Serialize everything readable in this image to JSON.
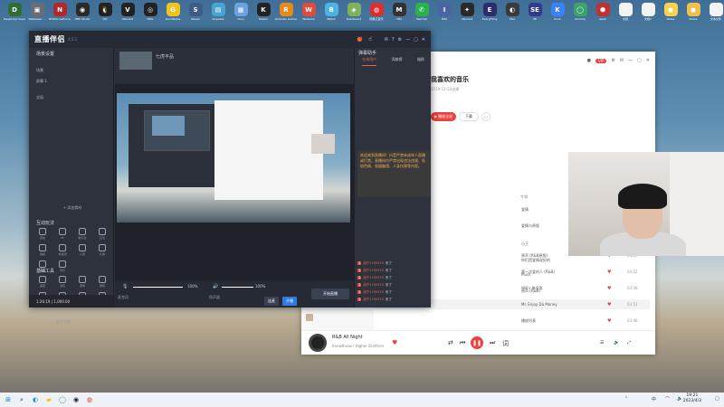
{
  "desktop": {
    "icons": [
      {
        "label": "Deepkdup Super...",
        "color": "#2f6e33",
        "glyph": "D"
      },
      {
        "label": "Wallpaper ...",
        "color": "#6b6d74",
        "glyph": "▣"
      },
      {
        "label": "NVIDIA GeForce...",
        "color": "#b3262b",
        "glyph": "N"
      },
      {
        "label": "OBS Studio",
        "color": "#2a2a2a",
        "glyph": "◉"
      },
      {
        "label": "QQ",
        "color": "#222",
        "glyph": "🐧"
      },
      {
        "label": "Valorant",
        "color": "#222",
        "glyph": "V"
      },
      {
        "label": "ROG",
        "color": "#222",
        "glyph": "◎"
      },
      {
        "label": "GoodNotes",
        "color": "#f2c31a",
        "glyph": "G"
      },
      {
        "label": "Steam",
        "color": "#3e5c88",
        "glyph": "S"
      },
      {
        "label": "Snipaste",
        "color": "#4ba3d4",
        "glyph": "▤"
      },
      {
        "label": "Docs",
        "color": "#6aa3df",
        "glyph": "▦"
      },
      {
        "label": "Kazam",
        "color": "#232323",
        "glyph": "K"
      },
      {
        "label": "Rockstar Games",
        "color": "#e88a1a",
        "glyph": "R"
      },
      {
        "label": "WeGame",
        "color": "#e44a3b",
        "glyph": "W"
      },
      {
        "label": "Bilibili",
        "color": "#4bb4e3",
        "glyph": "B"
      },
      {
        "label": "Dashboard",
        "color": "#7fb35a",
        "glyph": "◈"
      },
      {
        "label": "网易云音乐",
        "color": "#d9302c",
        "glyph": "◍"
      },
      {
        "label": "MSI",
        "color": "#333",
        "glyph": "M"
      },
      {
        "label": "WeChat",
        "color": "#2bb24c",
        "glyph": "✆"
      },
      {
        "label": "IDM",
        "color": "#4b64a4",
        "glyph": "I"
      },
      {
        "label": "Valorant",
        "color": "#2a2a2a",
        "glyph": "✦"
      },
      {
        "label": "Everything",
        "color": "#2d2d6d",
        "glyph": "E"
      },
      {
        "label": "Plex",
        "color": "#3a3a3a",
        "glyph": "◐"
      },
      {
        "label": "SE",
        "color": "#303c8a",
        "glyph": "SE"
      },
      {
        "label": "Kook",
        "color": "#3b82f6",
        "glyph": "K"
      },
      {
        "label": "Chrome",
        "color": "#3da36a",
        "glyph": "◯"
      },
      {
        "label": "Geek",
        "color": "#c42f2f",
        "glyph": "⬢"
      },
      {
        "label": "文档",
        "color": "#f2f2f2",
        "glyph": "▯"
      },
      {
        "label": "文档2",
        "color": "#f2f2f2",
        "glyph": "▯"
      },
      {
        "label": "Notes",
        "color": "#f6d34a",
        "glyph": "◼"
      },
      {
        "label": "Note2",
        "color": "#f1c04a",
        "glyph": "◼"
      },
      {
        "label": "文本文件",
        "color": "#f2f2f2",
        "glyph": "▯"
      }
    ]
  },
  "stream_app": {
    "logo": "直播伴侣",
    "version": "4.5.1",
    "scene_panel_title": "场景设置",
    "scene_items": [
      "场景",
      "屏幕 1",
      "全局"
    ],
    "add_source_label": "+ 添加素材",
    "interaction_title": "互动玩法",
    "interaction_icons": [
      "连线",
      "PK",
      "聊天室",
      "红包",
      "福袋",
      "粉丝团",
      "心愿",
      "礼物",
      "投票",
      "音乐"
    ],
    "tools_title": "基础工具",
    "tools_icons": [
      "美颜",
      "滤镜",
      "录屏",
      "弹幕",
      "分享",
      "直播间",
      "设置",
      "更多"
    ],
    "more_label": "更多功能",
    "go_live_label": "开始直播",
    "mic_label": "麦克风",
    "speaker_label": "扬声器",
    "mic_pct": "100%",
    "speaker_pct": "100%",
    "chat_panel_title": "弹幕助手",
    "chat_tabs": [
      "在线用户",
      "贡献榜",
      "福袋"
    ],
    "notice_text": "欢迎来到直播间！抖音严禁未成年人直播或打赏。直播间内严禁出现违法违规、低俗色情、吸烟酗酒、人身伤害等内容。",
    "chat_lines": [
      {
        "tag": "1",
        "user": "用户1790329",
        "text": "来了"
      },
      {
        "tag": "1",
        "user": "用户1790329",
        "text": "来了"
      },
      {
        "tag": "1",
        "user": "用户1790329",
        "text": "来了"
      },
      {
        "tag": "1",
        "user": "用户1790329",
        "text": "来了"
      },
      {
        "tag": "1",
        "user": "用户1790329",
        "text": "来了"
      },
      {
        "tag": "1",
        "user": "用户1790329",
        "text": "来了"
      }
    ],
    "bottom_status": "1:26:19 | 1,000.00",
    "bottom_btn1": "连麦",
    "bottom_btn2": "开播",
    "viewer_count": "0"
  },
  "music_app": {
    "title": "我喜欢的音乐",
    "meta": "2019-12-20创建",
    "play_all": "▶ 播放全部",
    "download": "下载",
    "vip_badge": "VIP",
    "column_album": "专辑",
    "albums": [
      "爱情",
      "爱情与原版",
      "小王",
      "你们是爱情说好的",
      "Pluck",
      "原声 (R&B)"
    ],
    "rows": [
      {
        "title": "",
        "album": "原声 (R&B原版)",
        "duration": "04:29"
      },
      {
        "title": "",
        "album": "第一次爱的人 (R&B)",
        "duration": "04:01"
      },
      {
        "title": "",
        "album": "Will's 单身男",
        "duration": "03:38"
      },
      {
        "title": "",
        "album": "Mr. Enjoy Da Money",
        "duration": "03:51"
      },
      {
        "title": "",
        "album": "播放列表",
        "duration": "03:46"
      },
      {
        "title": "",
        "album": "播放列表",
        "duration": "03:33"
      }
    ],
    "current_song": "R&B All Night",
    "current_artist": "KnowKnow / Higher Brothers",
    "playing_row_title": "R&B All Night",
    "playing_row_artist": "KnowKnow / Higher Brothers",
    "sidebar_items": [
      "",
      "",
      "",
      "",
      "",
      ""
    ]
  },
  "taskbar": {
    "time": "19:21",
    "date": "2023/4/3"
  }
}
